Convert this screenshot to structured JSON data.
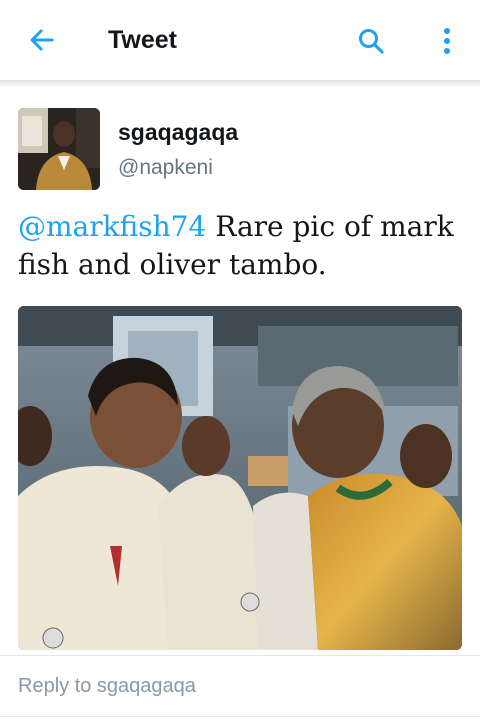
{
  "header": {
    "title": "Tweet",
    "back_icon": "arrow-left-icon",
    "search_icon": "search-icon",
    "more_icon": "more-vertical-icon",
    "accent_color": "#1da1f2"
  },
  "tweet": {
    "display_name": "sgaqagaqa",
    "handle": "@napkeni",
    "mention": "@markfish74",
    "text": " Rare pic of mark fish and oliver tambo."
  },
  "reply": {
    "placeholder": "Reply to sgaqagaqa"
  }
}
